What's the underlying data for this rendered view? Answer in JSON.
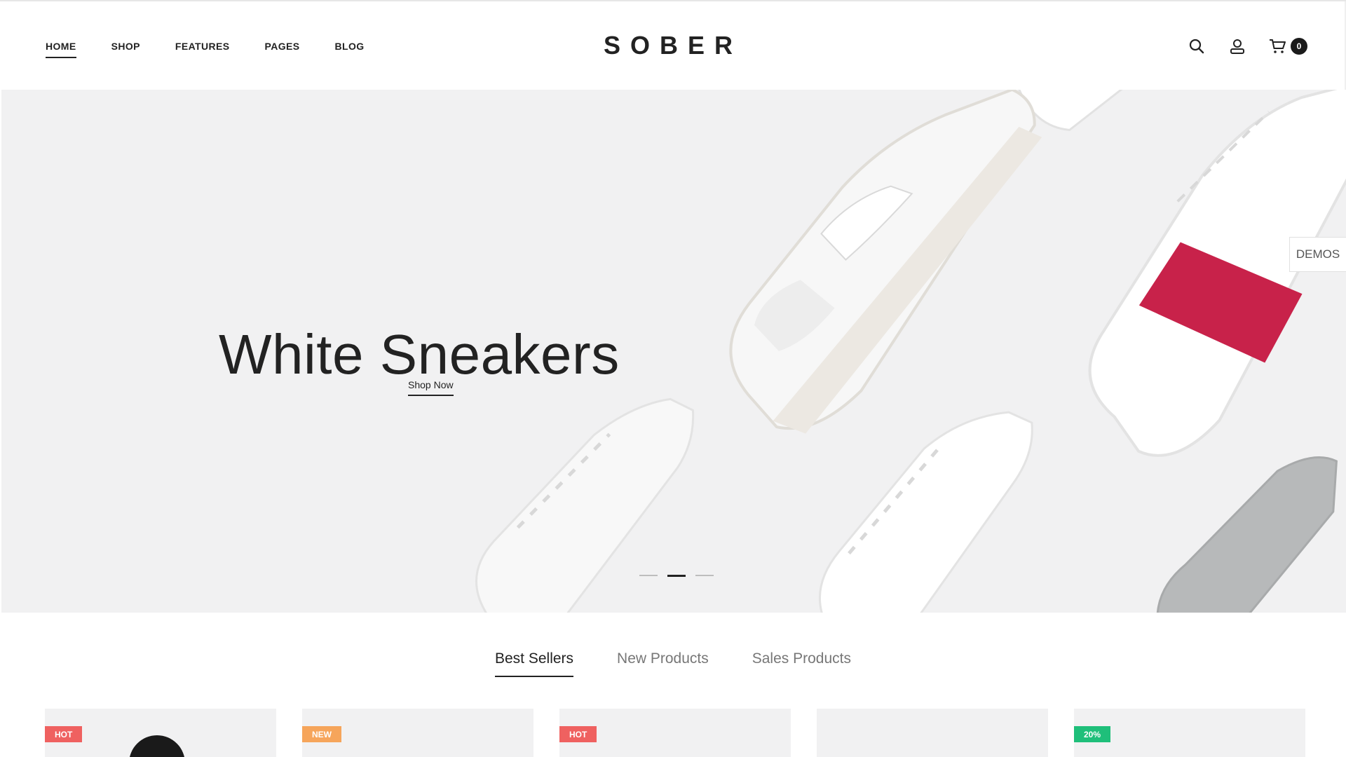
{
  "header": {
    "nav": [
      "HOME",
      "SHOP",
      "FEATURES",
      "PAGES",
      "BLOG"
    ],
    "logo": "SOBER",
    "cart_count": "0",
    "icons": [
      "search-icon",
      "account-icon",
      "cart-icon"
    ]
  },
  "hero": {
    "title": "White Sneakers",
    "cta": "Shop Now",
    "slides": 3,
    "active_slide": 2,
    "demos_label": "DEMOS"
  },
  "tabs": [
    "Best Sellers",
    "New Products",
    "Sales Products"
  ],
  "products": [
    {
      "badge": "HOT"
    },
    {
      "badge": "NEW"
    },
    {
      "badge": "HOT"
    },
    {
      "badge": ""
    },
    {
      "badge": "20%"
    }
  ],
  "colors": {
    "hot": "#ef6160",
    "new": "#f6a55b",
    "sale": "#1fbf7a",
    "hero_bg": "#f1f1f2",
    "accent_stripe": "#c8224a"
  }
}
